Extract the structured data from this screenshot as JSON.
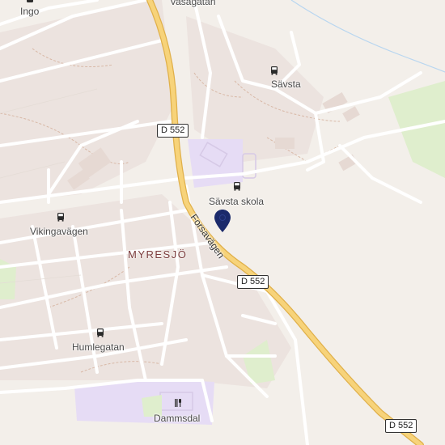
{
  "map": {
    "places": {
      "ingo": "Ingo",
      "vasagatan": "Vasagatan",
      "savsta": "Sävsta",
      "savsta_skola": "Sävsta skola",
      "vikingavagen": "Vikingavägen",
      "myresjo": "MYRESJÖ",
      "humlegatan": "Humlegatan",
      "dammsdal": "Dammsdal"
    },
    "roads": {
      "forsavagen": "Forsavägen",
      "shield_1": "D 552",
      "shield_2": "D 552",
      "shield_3": "D 552"
    },
    "icons": {
      "bus_stop": "bus-icon",
      "restaurant": "restaurant-icon",
      "marker": "location-pin-icon"
    },
    "colors": {
      "background": "#f3efea",
      "main_road": "#f7d37a",
      "main_road_casing": "#e0b04a",
      "minor_road": "#ffffff",
      "school_area": "#e6dcf5",
      "park": "#dfeecd",
      "pin": "#1b2a6b"
    }
  }
}
